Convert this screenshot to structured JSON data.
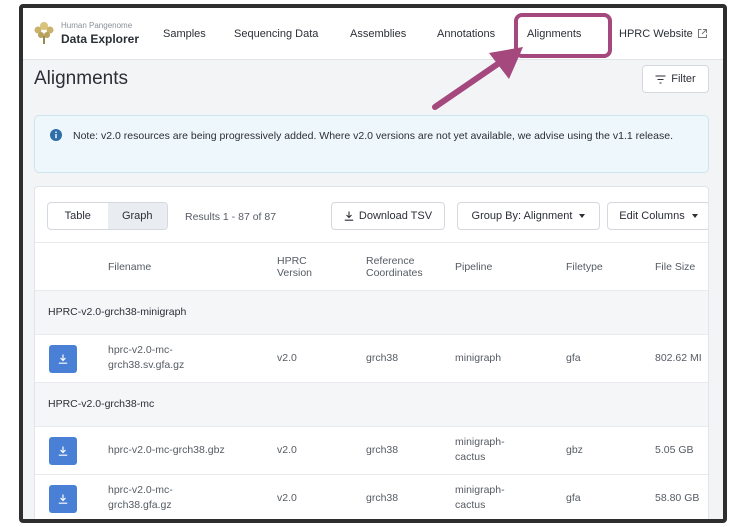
{
  "header": {
    "brand_sub": "Human Pangenome",
    "brand_main": "Data Explorer",
    "nav": [
      {
        "label": "Samples"
      },
      {
        "label": "Sequencing Data"
      },
      {
        "label": "Assemblies"
      },
      {
        "label": "Annotations"
      },
      {
        "label": "Alignments"
      },
      {
        "label": "HPRC Website"
      }
    ],
    "highlight_color": "#a4487e"
  },
  "page": {
    "title": "Alignments",
    "filter_label": "Filter"
  },
  "notice": {
    "text": "Note: v2.0 resources are being progressively added. Where v2.0 versions are not yet available, we advise using the v1.1 release."
  },
  "toolbar": {
    "view_table": "Table",
    "view_graph": "Graph",
    "results": "Results 1 - 87 of 87",
    "download": "Download TSV",
    "group_by": "Group By: Alignment",
    "edit_columns": "Edit Columns"
  },
  "columns": {
    "filename": "Filename",
    "hprc_version": [
      "HPRC",
      "Version"
    ],
    "reference": [
      "Reference",
      "Coordinates"
    ],
    "pipeline": "Pipeline",
    "filetype": "Filetype",
    "filesize": "File Size"
  },
  "groups": [
    {
      "label": "HPRC-v2.0-grch38-minigraph",
      "rows": [
        {
          "filename": [
            "hprc-v2.0-mc-",
            "grch38.sv.gfa.gz"
          ],
          "version": "v2.0",
          "reference": "grch38",
          "pipeline": [
            "minigraph"
          ],
          "filetype": "gfa",
          "filesize": "802.62 MI"
        }
      ]
    },
    {
      "label": "HPRC-v2.0-grch38-mc",
      "rows": [
        {
          "filename": [
            "hprc-v2.0-mc-grch38.gbz"
          ],
          "version": "v2.0",
          "reference": "grch38",
          "pipeline": [
            "minigraph-",
            "cactus"
          ],
          "filetype": "gbz",
          "filesize": "5.05 GB"
        },
        {
          "filename": [
            "hprc-v2.0-mc-",
            "grch38.gfa.gz"
          ],
          "version": "v2.0",
          "reference": "grch38",
          "pipeline": [
            "minigraph-",
            "cactus"
          ],
          "filetype": "gfa",
          "filesize": "58.80 GB"
        }
      ]
    }
  ]
}
